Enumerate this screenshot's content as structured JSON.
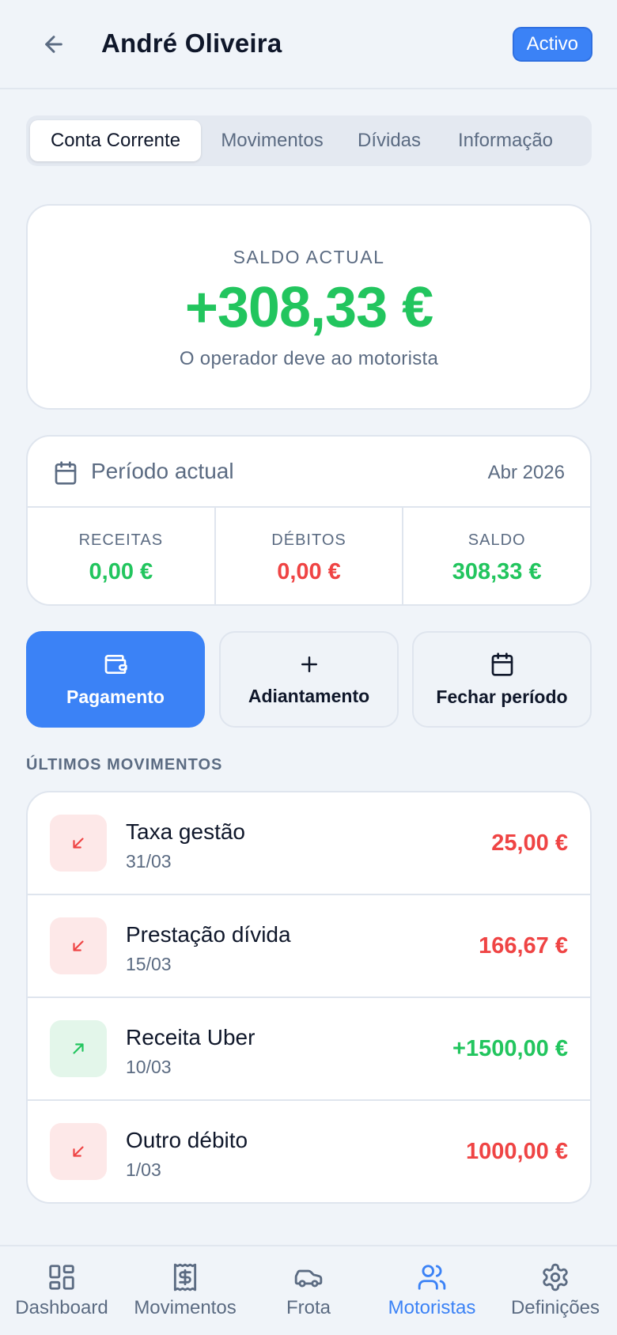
{
  "header": {
    "title": "André Oliveira",
    "status": "Activo"
  },
  "tabs": [
    {
      "label": "Conta Corrente",
      "active": true
    },
    {
      "label": "Movimentos",
      "active": false
    },
    {
      "label": "Dívidas",
      "active": false
    },
    {
      "label": "Informação",
      "active": false
    }
  ],
  "balance": {
    "label": "SALDO ACTUAL",
    "value": "+308,33 €",
    "caption": "O operador deve ao motorista"
  },
  "period": {
    "title": "Período actual",
    "date": "Abr 2026",
    "receitas": {
      "label": "RECEITAS",
      "value": "0,00 €"
    },
    "debitos": {
      "label": "DÉBITOS",
      "value": "0,00 €"
    },
    "saldo": {
      "label": "SALDO",
      "value": "308,33 €"
    }
  },
  "actions": {
    "pagamento": "Pagamento",
    "adiantamento": "Adiantamento",
    "fechar": "Fechar período"
  },
  "movements": {
    "title": "ÚLTIMOS MOVIMENTOS",
    "items": [
      {
        "title": "Taxa gestão",
        "date": "31/03",
        "amount": "25,00 €",
        "type": "debit"
      },
      {
        "title": "Prestação dívida",
        "date": "15/03",
        "amount": "166,67 €",
        "type": "debit"
      },
      {
        "title": "Receita Uber",
        "date": "10/03",
        "amount": "+1500,00 €",
        "type": "credit"
      },
      {
        "title": "Outro débito",
        "date": "1/03",
        "amount": "1000,00 €",
        "type": "debit"
      }
    ]
  },
  "nav": [
    {
      "label": "Dashboard",
      "icon": "dashboard-icon",
      "active": false
    },
    {
      "label": "Movimentos",
      "icon": "receipt-icon",
      "active": false
    },
    {
      "label": "Frota",
      "icon": "car-icon",
      "active": false
    },
    {
      "label": "Motoristas",
      "icon": "users-icon",
      "active": true
    },
    {
      "label": "Definições",
      "icon": "gear-icon",
      "active": false
    }
  ],
  "colors": {
    "accent": "#3b82f6",
    "positive": "#22c55e",
    "negative": "#ef4444",
    "muted": "#5b6b82",
    "background": "#f0f4f9"
  }
}
